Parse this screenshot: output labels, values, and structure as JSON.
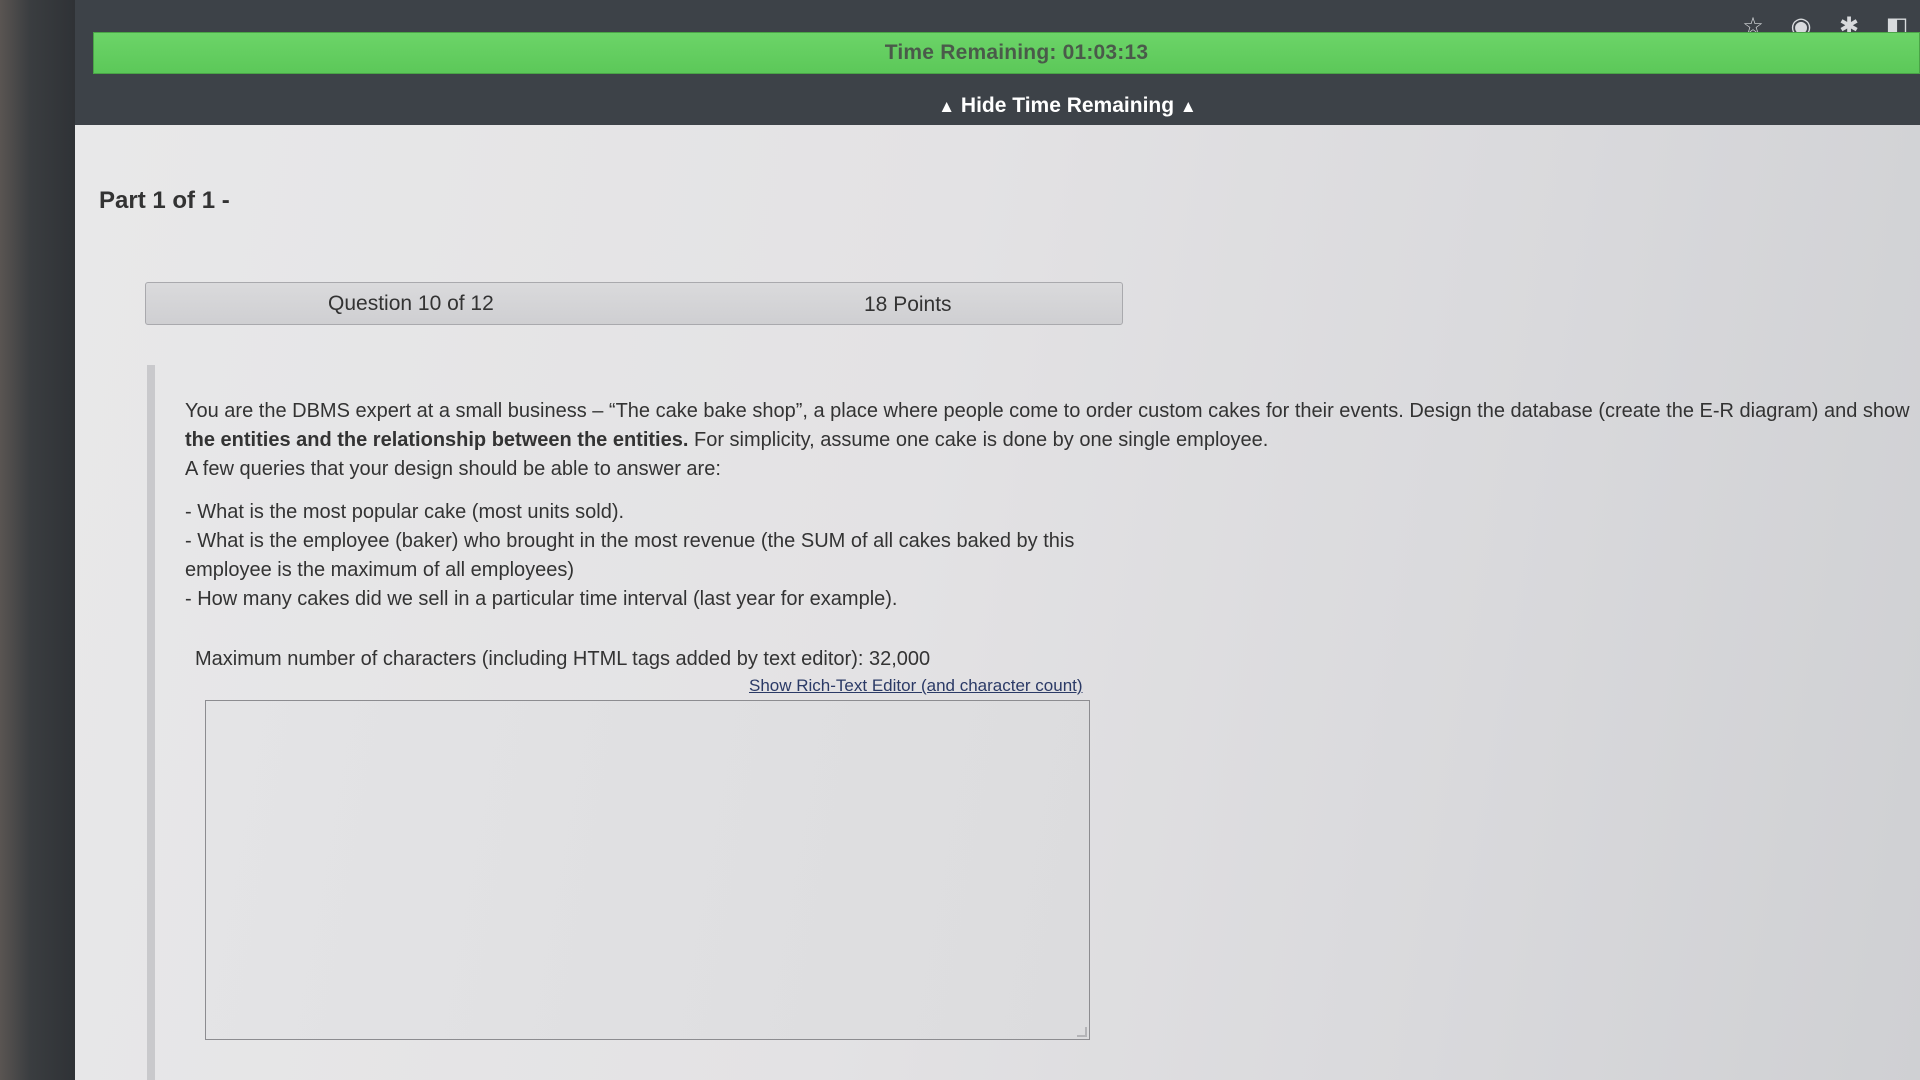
{
  "timer": {
    "label": "Time Remaining: 01:03:13",
    "hide_label": "Hide Time Remaining",
    "color": "#5cc859"
  },
  "browser_icons": [
    "star-icon",
    "profile-icon",
    "extensions-icon",
    "sidepanel-icon"
  ],
  "part": {
    "title": "Part 1 of 1 -"
  },
  "question": {
    "number": "Question 10 of 12",
    "points": "18 Points",
    "intro_1": "You are the DBMS expert at a small business – “The cake bake shop”, a place where people come to order custom cakes for their events. Design the database (create the E-R diagram) and show",
    "intro_bold": "the entities and the relationship between the entities.",
    "intro_2": " For simplicity, assume one cake is done by one single employee.",
    "queries_intro": "A few queries that your design should be able to answer are:",
    "bullets": [
      "- What is the most popular cake (most units sold).",
      "- What is the employee (baker) who brought in the most revenue (the SUM of all cakes baked by this",
      "employee is the maximum of all employees)",
      "- How many cakes did we sell in a particular time interval (last year for example)."
    ]
  },
  "answer": {
    "max_chars_label": "Maximum number of characters (including HTML tags added by text editor): 32,000",
    "rich_text_link": "Show Rich-Text Editor (and character count)",
    "value": ""
  }
}
